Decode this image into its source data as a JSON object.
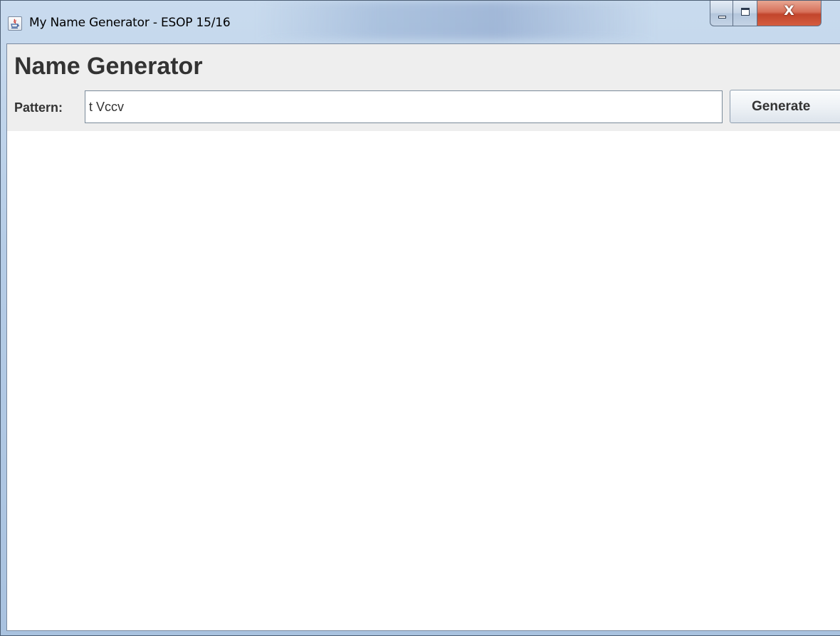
{
  "window": {
    "title": "My Name Generator - ESOP 15/16",
    "controls": {
      "minimize_icon": "minimize-icon",
      "maximize_icon": "maximize-icon",
      "close_glyph": "X"
    }
  },
  "app": {
    "heading": "Name Generator",
    "pattern_label": "Pattern:",
    "pattern_value": "t Vccv",
    "generate_label": "Generate"
  },
  "colors": {
    "panel_background": "#eeeeee",
    "text": "#333333",
    "close_button": "#c7452c"
  }
}
